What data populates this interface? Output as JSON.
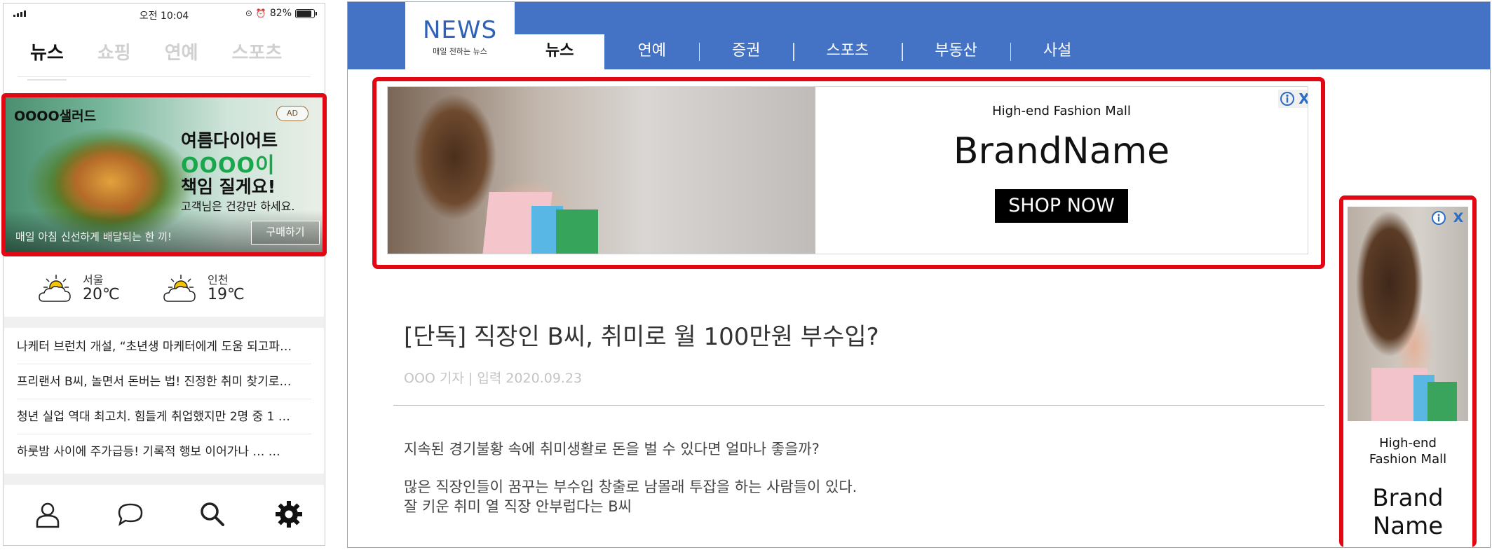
{
  "phone": {
    "status": {
      "time": "오전 10:04",
      "battery": "82%"
    },
    "tabs": [
      "뉴스",
      "쇼핑",
      "연예",
      "스포츠"
    ],
    "ad": {
      "brand": "OOOO샐러드",
      "badge": "AD",
      "line1": "여름다이어트",
      "line2": "OOOO이",
      "line3": "책임 질게요!",
      "line4": "고객님은 건강만 하세요.",
      "footer": "매일 아침 신선하게 배달되는 한 끼!",
      "buy_label": "구매하기"
    },
    "weather": [
      {
        "city": "서울",
        "temp": "20℃",
        "icon": "sun-cloud-icon"
      },
      {
        "city": "인천",
        "temp": "19℃",
        "icon": "sun-cloud-icon"
      }
    ],
    "news": [
      "나케터 브런치 개설, “초년생 마케터에게 도움 되고파…",
      "프리랜서 B씨, 놀면서 돈버는 법! 진정한 취미 찾기로…",
      "청년 실업 역대 최고치. 힘들게 취업했지만 2명 중 1 …",
      "하룻밤 사이에 주가급등! 기록적 행보 이어가나 … …"
    ],
    "bottom_nav": [
      "user-icon",
      "chat-icon",
      "search-icon",
      "gear-icon"
    ]
  },
  "desktop": {
    "logo": {
      "title": "NEWS",
      "subtitle": "매일 전하는 뉴스"
    },
    "nav": [
      "뉴스",
      "연예",
      "증권",
      "스포츠",
      "부동산",
      "사설"
    ],
    "banner": {
      "mall": "High-end Fashion Mall",
      "brand": "BrandName",
      "cta": "SHOP NOW",
      "close": "X"
    },
    "article": {
      "headline": "[단독] 직장인 B씨, 취미로 월 100만원 부수입?",
      "byline": "OOO 기자  |  입력 2020.09.23",
      "p1": "지속된 경기불황 속에 취미생활로 돈을 벌 수 있다면 얼마나 좋을까?",
      "p2": "많은 직장인들이 꿈꾸는 부수입 창출로 남몰래 투잡을 하는 사람들이 있다.",
      "p3": "잘 키운 취미 열 직장 안부럽다는 B씨"
    },
    "side_ad": {
      "mall_line1": "High-end",
      "mall_line2": "Fashion Mall",
      "brand_line1": "Brand",
      "brand_line2": "Name",
      "close": "X"
    }
  },
  "colors": {
    "brand_blue": "#4472c4",
    "highlight_red": "#e30613",
    "ad_green": "#1aa64a",
    "info_blue": "#2b6cc4"
  }
}
